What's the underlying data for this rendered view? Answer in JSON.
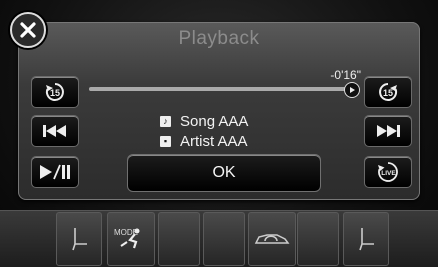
{
  "screen": {
    "title": "Playback"
  },
  "playback": {
    "time_remaining": "-0'16\"",
    "progress_percent": 100,
    "song": "Song AAA",
    "artist": "Artist AAA",
    "ok_label": "OK"
  },
  "controls": {
    "skip_back_label": "15",
    "skip_forward_label": "15",
    "live_label": "LIVE"
  },
  "bottom_bar": {
    "mode_label": "MODE"
  },
  "icons": {
    "close": "close-icon",
    "skip_back_15": "rewind-15-icon",
    "skip_forward_15": "forward-15-icon",
    "prev": "previous-track-icon",
    "next": "next-track-icon",
    "play_pause": "play-pause-icon",
    "live": "live-icon",
    "song": "song-icon",
    "artist": "artist-icon",
    "seat_left": "seat-heater-left-icon",
    "mode": "air-mode-icon",
    "car": "car-recirculation-icon",
    "seat_right": "seat-heater-right-icon"
  }
}
